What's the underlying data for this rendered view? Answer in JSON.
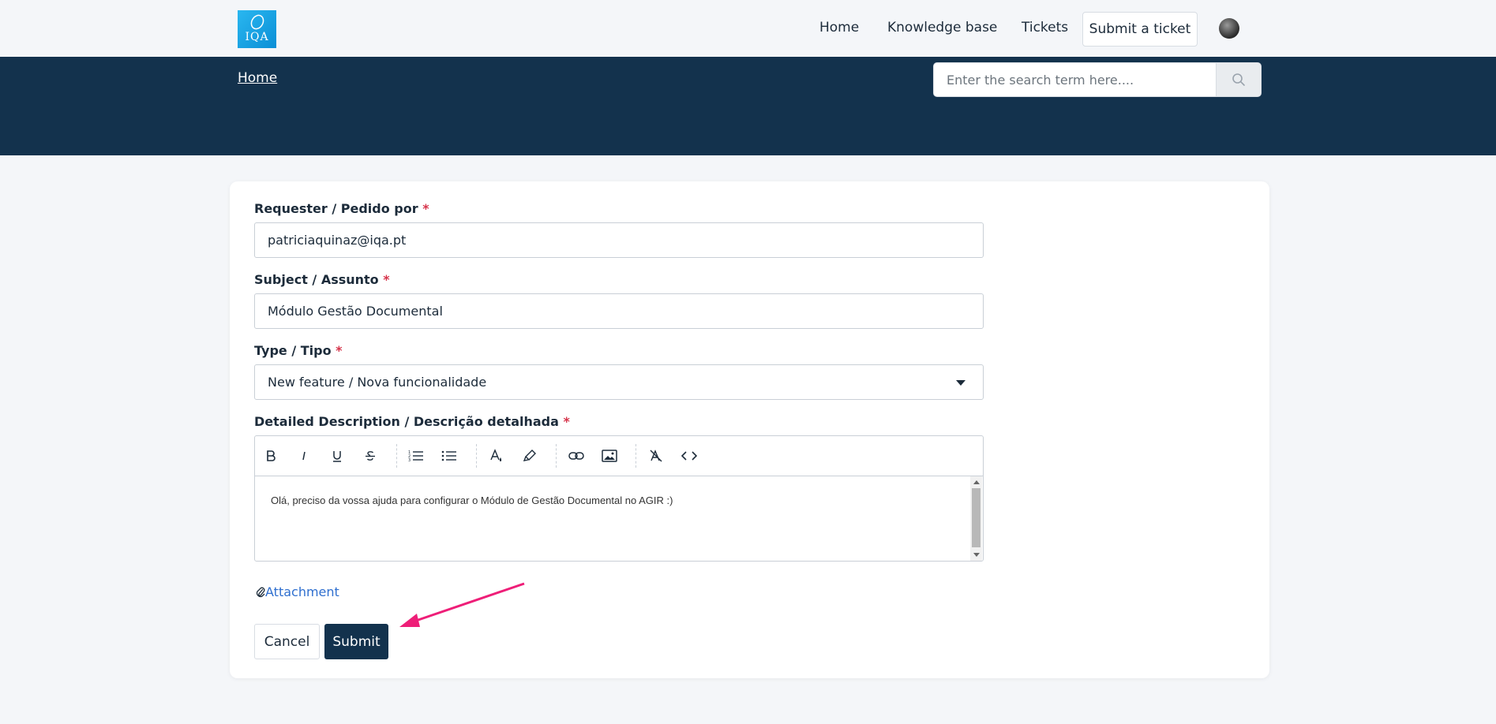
{
  "header": {
    "logo_text": "IQA",
    "nav": {
      "home": "Home",
      "knowledge_base": "Knowledge base",
      "tickets": "Tickets",
      "submit_ticket": "Submit a ticket"
    }
  },
  "hero": {
    "breadcrumb": "Home",
    "search_placeholder": "Enter the search term here...."
  },
  "form": {
    "requester": {
      "label": "Requester / Pedido por",
      "required": "*",
      "value": "patriciaquinaz@iqa.pt"
    },
    "subject": {
      "label": "Subject / Assunto",
      "required": "*",
      "value": "Módulo Gestão Documental"
    },
    "type": {
      "label": "Type / Tipo",
      "required": "*",
      "selected": "New feature / Nova funcionalidade"
    },
    "description": {
      "label": "Detailed Description / Descrição detalhada",
      "required": "*",
      "value": "Olá, preciso da vossa ajuda para configurar o Módulo de Gestão Documental no AGIR :)"
    },
    "attachment_label": "Attachment",
    "cancel_label": "Cancel",
    "submit_label": "Submit"
  },
  "colors": {
    "brand_dark": "#13324d",
    "required": "#d6334a",
    "link": "#2f6fcf",
    "annotation_arrow": "#ee1e78"
  }
}
